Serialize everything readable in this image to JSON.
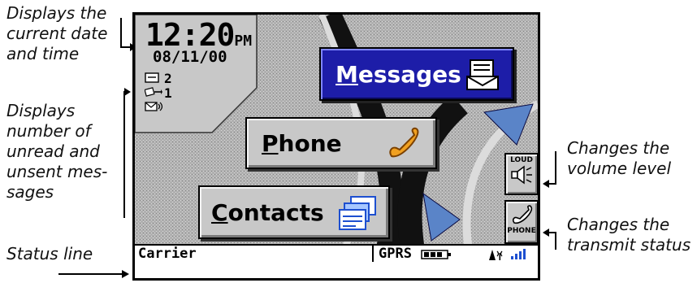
{
  "callouts": {
    "datetime": "Displays the\ncurrent date\nand time",
    "unread": "Displays\nnumber of\nunread and\nunsent mes-\nsages",
    "status_line": "Status line",
    "volume": "Changes the\nvolume level",
    "transmit": "Changes the\ntransmit status"
  },
  "status": {
    "time": "12:20",
    "ampm": "PM",
    "date": "08/11/00",
    "unread_count": "2",
    "unsent_count": "1"
  },
  "buttons": {
    "messages": {
      "accel": "M",
      "rest": "essages"
    },
    "phone": {
      "accel": "P",
      "rest": "hone"
    },
    "contacts": {
      "accel": "C",
      "rest": "ontacts"
    },
    "loud": "LOUD",
    "phone_side": "PHONE"
  },
  "statusbar": {
    "carrier": "Carrier",
    "network": "GPRS"
  },
  "colors": {
    "blue_button": "#1d1da8",
    "gray_button": "#c8c8c8",
    "arrow_blue": "#5a84c8",
    "signal": "#1d4fd0"
  },
  "icons": {
    "messages": "envelope-tray-icon",
    "phone": "handset-icon",
    "contacts": "address-cards-icon",
    "speaker": "speaker-icon",
    "phone_side": "handset-icon",
    "unread": "envelope-icon",
    "unsent": "outbox-icon",
    "voicemail": "voicemail-icon",
    "battery": "battery-icon",
    "antenna": "antenna-icon",
    "signal": "signal-bars-icon"
  }
}
